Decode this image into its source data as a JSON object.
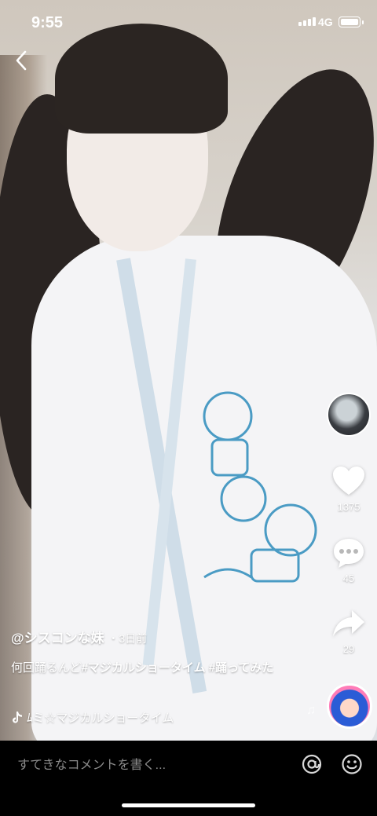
{
  "status_bar": {
    "time": "9:55",
    "network": "4G"
  },
  "post": {
    "username": "@シスコンな妹",
    "separator": "・",
    "posted_ago": "3日前",
    "caption_text": "何回踊るんど",
    "hashtags": [
      "#マジカルショータイム",
      "#踊ってみた"
    ],
    "music": "ﾑミ☆マジカルショータイム"
  },
  "actions": {
    "likes": "1375",
    "comments": "45",
    "shares": "29"
  },
  "comment_bar": {
    "placeholder": "すてきなコメントを書く..."
  },
  "colors": {
    "background": "#000000",
    "text": "#ffffff",
    "placeholder": "#8a8a8a"
  }
}
